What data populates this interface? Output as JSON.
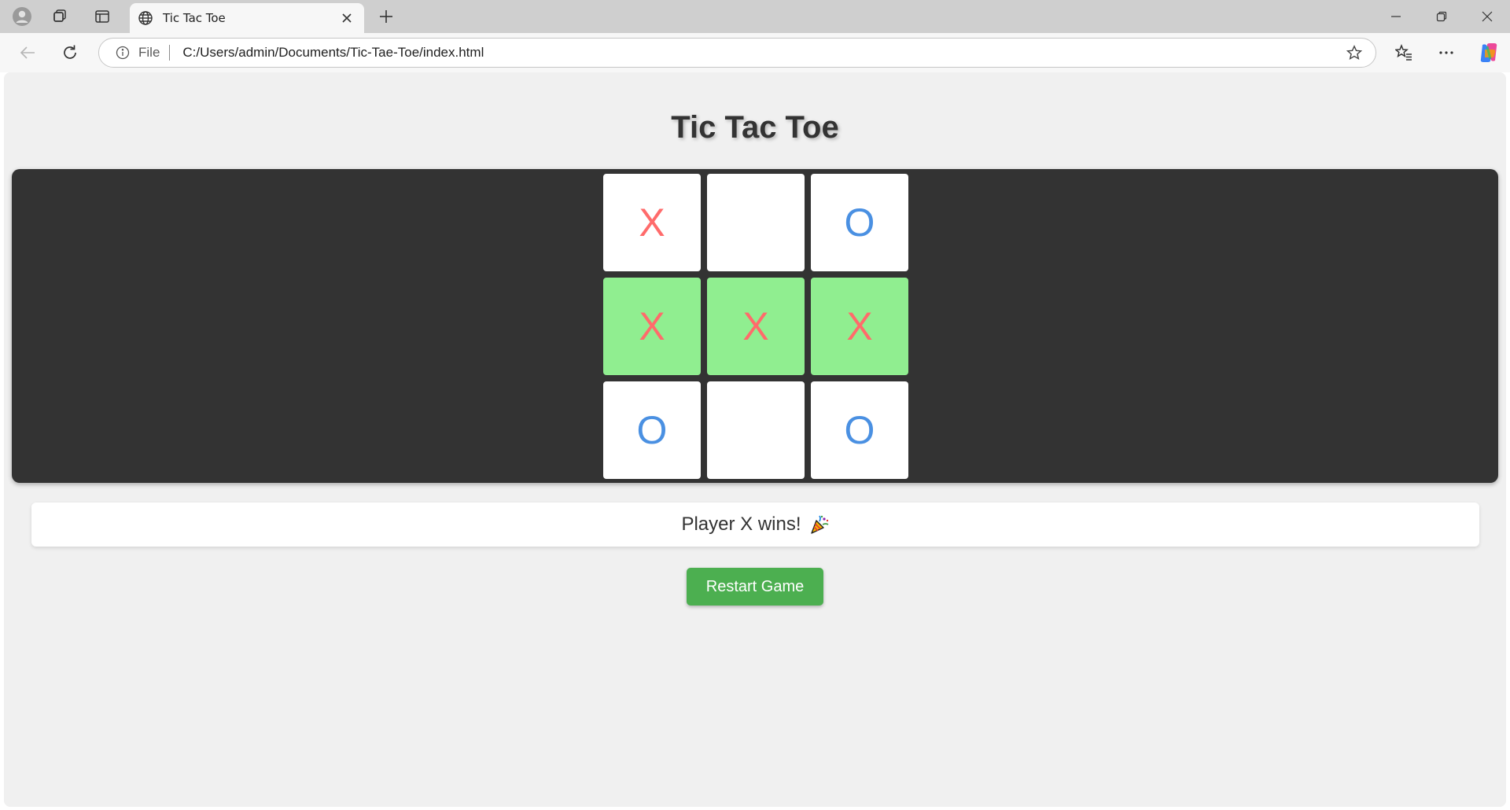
{
  "browser": {
    "tab_title": "Tic Tac Toe",
    "address_scheme": "File",
    "address_url": "C:/Users/admin/Documents/Tic-Tae-Toe/index.html"
  },
  "page": {
    "title": "Tic Tac Toe",
    "board": [
      {
        "mark": "X",
        "win": false
      },
      {
        "mark": "",
        "win": false
      },
      {
        "mark": "O",
        "win": false
      },
      {
        "mark": "X",
        "win": true
      },
      {
        "mark": "X",
        "win": true
      },
      {
        "mark": "X",
        "win": true
      },
      {
        "mark": "O",
        "win": false
      },
      {
        "mark": "",
        "win": false
      },
      {
        "mark": "O",
        "win": false
      }
    ],
    "status": "Player X wins!",
    "restart_label": "Restart Game"
  },
  "colors": {
    "x_mark": "#ff6b6b",
    "o_mark": "#4a90e2",
    "win_cell": "#90ee90",
    "board_bg": "#333333",
    "restart_button": "#4caf50"
  },
  "icons": {
    "status_icon": "party-popper-icon"
  }
}
